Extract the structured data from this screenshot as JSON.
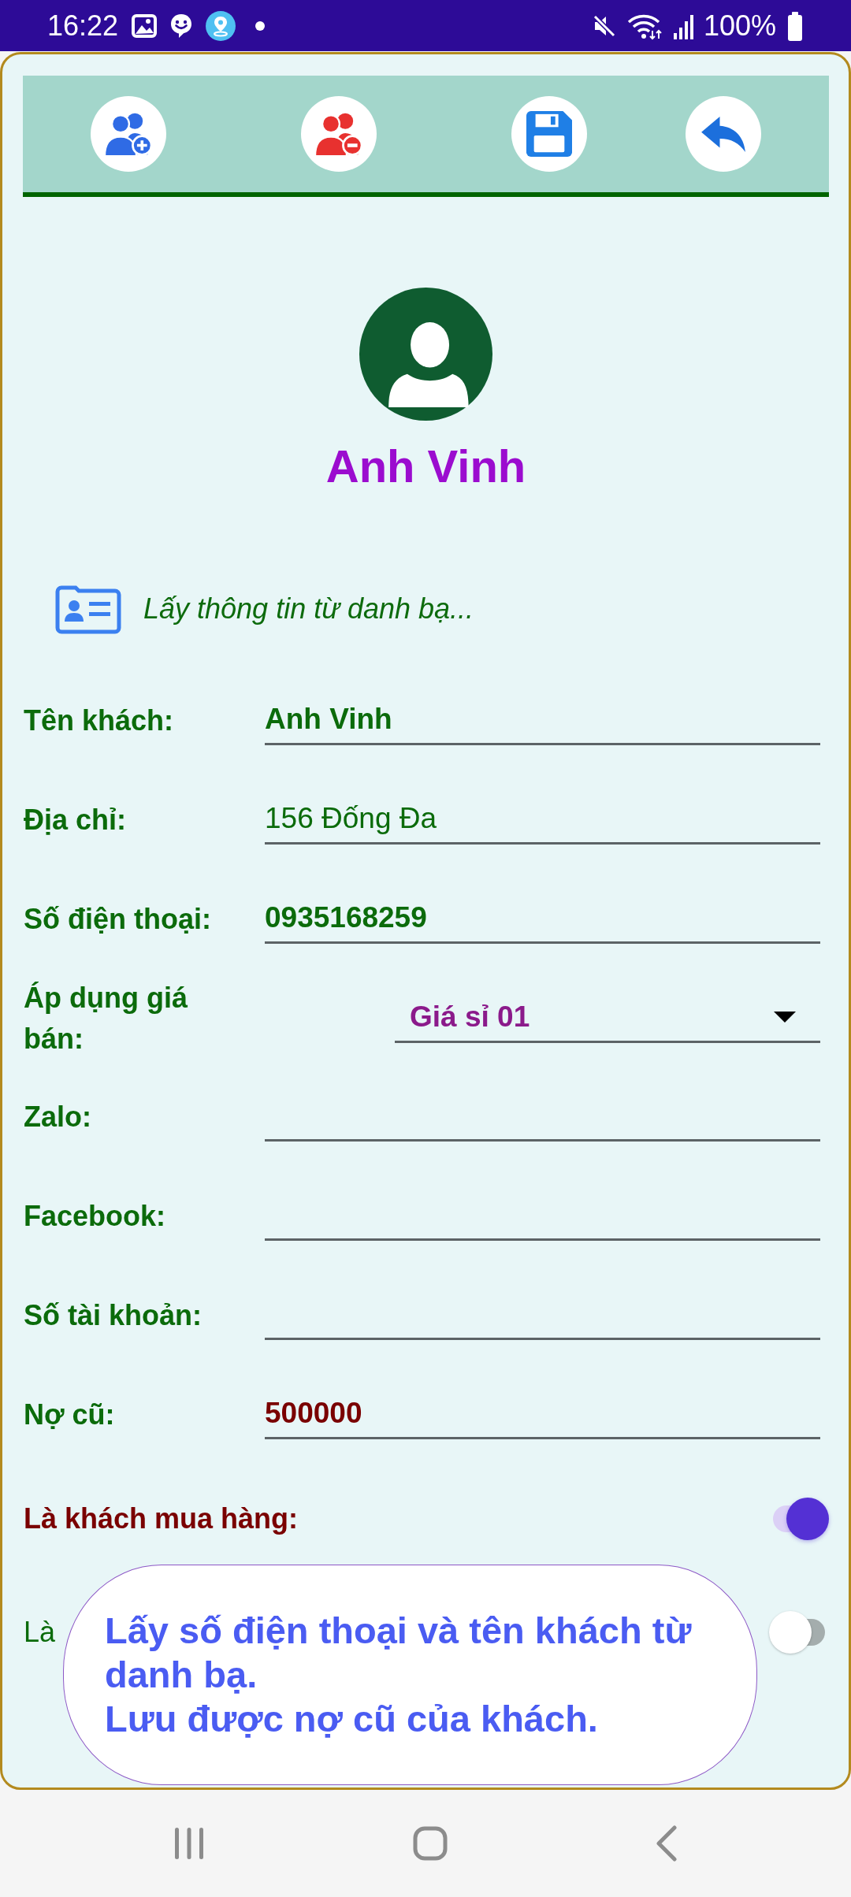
{
  "status_bar": {
    "time": "16:22",
    "battery": "100%"
  },
  "profile": {
    "name": "Anh Vinh"
  },
  "contacts_link": {
    "label": "Lấy thông tin từ danh bạ..."
  },
  "form": {
    "fields": [
      {
        "kind": "text",
        "label": "Tên khách:",
        "value": "Anh Vinh",
        "color": "#0b6b0b",
        "bold": true
      },
      {
        "kind": "text",
        "label": "Địa chỉ:",
        "value": "156 Đống Đa",
        "color": "#0b6b0b",
        "bold": false
      },
      {
        "kind": "text",
        "label": "Số điện thoại:",
        "value": "0935168259",
        "color": "#0b6b0b",
        "bold": true
      },
      {
        "kind": "dropdown",
        "label": "Áp dụng giá bán:",
        "value": "Giá sỉ 01",
        "color": "#8b1a8b",
        "bold": true
      },
      {
        "kind": "text",
        "label": "Zalo:"
      },
      {
        "kind": "text",
        "label": "Facebook:"
      },
      {
        "kind": "text",
        "label": "Số tài khoản:"
      },
      {
        "kind": "text",
        "label": "Nợ cũ:",
        "value": "500000",
        "color": "#7a0000",
        "bold": true
      },
      {
        "kind": "toggle",
        "label": "Là khách mua hàng:",
        "on": true,
        "color": "#7a0000",
        "bold": true
      },
      {
        "kind": "toggle",
        "label": "Là",
        "on": false,
        "color": "#0b6b0b",
        "bold": false
      }
    ]
  },
  "tooltip": {
    "lines": [
      "Lấy số điện thoại và tên khách từ danh bạ.",
      "Lưu được nợ cũ của khách."
    ]
  }
}
